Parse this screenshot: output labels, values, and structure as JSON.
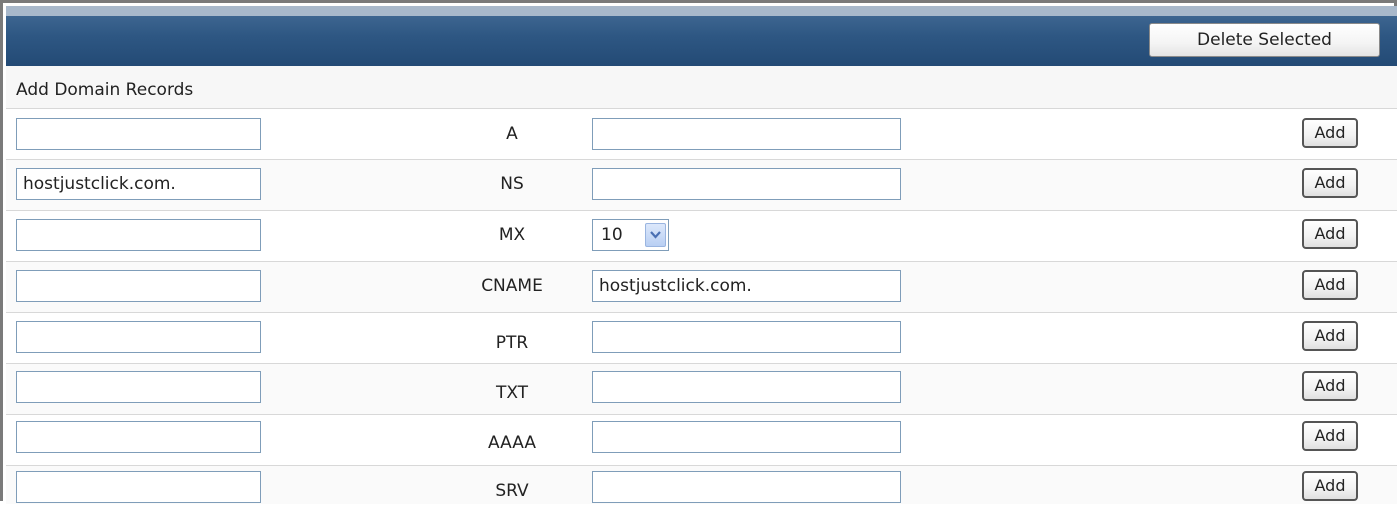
{
  "toolbar": {
    "delete_selected_label": "Delete Selected"
  },
  "section": {
    "title": "Add Domain Records"
  },
  "records": [
    {
      "type": "A",
      "name": "",
      "value": "",
      "add_label": "Add"
    },
    {
      "type": "NS",
      "name": "hostjustclick.com.",
      "value": "",
      "add_label": "Add"
    },
    {
      "type": "MX",
      "name": "",
      "priority": "10",
      "add_label": "Add"
    },
    {
      "type": "CNAME",
      "name": "",
      "value": "hostjustclick.com.",
      "add_label": "Add"
    },
    {
      "type": "PTR",
      "name": "",
      "value": "",
      "add_label": "Add"
    },
    {
      "type": "TXT",
      "name": "",
      "value": "",
      "add_label": "Add"
    },
    {
      "type": "AAAA",
      "name": "",
      "value": "",
      "add_label": "Add"
    },
    {
      "type": "SRV",
      "name": "",
      "value": "",
      "add_label": "Add"
    }
  ],
  "colors": {
    "header": "#2e5783",
    "input_border": "#7f9db9"
  }
}
